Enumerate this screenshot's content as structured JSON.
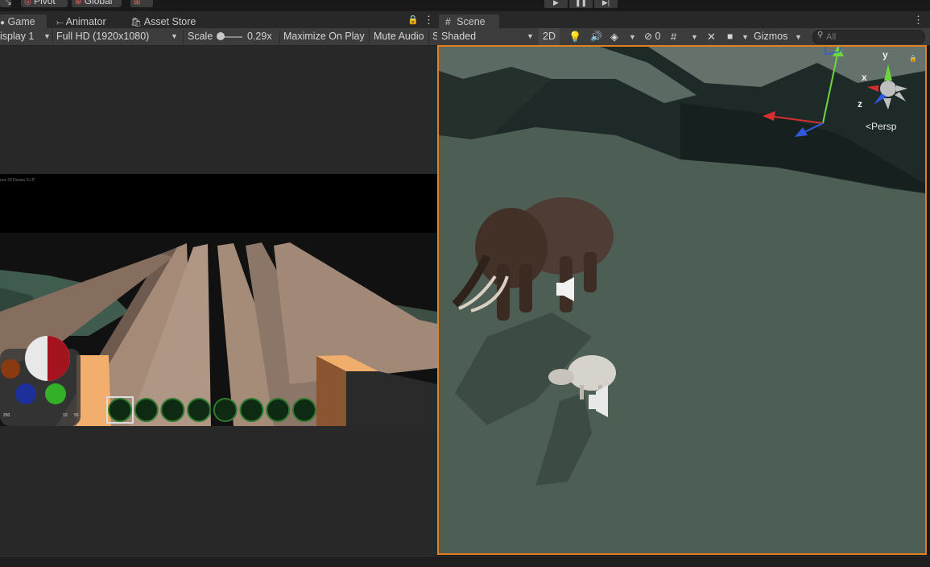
{
  "toolbar": {
    "pivot_label": "Pivot",
    "global_label": "Global",
    "play_icon": "play-icon",
    "pause_icon": "pause-icon",
    "step_icon": "step-icon"
  },
  "game_panel": {
    "tabs": [
      {
        "label": "Game",
        "icon": "game-icon",
        "active": true
      },
      {
        "label": "Animator",
        "icon": "animator-icon",
        "active": false
      },
      {
        "label": "Asset Store",
        "icon": "asset-store-icon",
        "active": false
      }
    ],
    "display": "isplay 1",
    "resolution": "Full HD (1920x1080)",
    "scale_label": "Scale",
    "scale_value": "0.29x",
    "scale_fraction": 0.1,
    "maximize_label": "Maximize On Play",
    "mute_label": "Mute Audio",
    "overflow_label": "S",
    "hud": {
      "title_text": "nce Of Dream S.I.P",
      "stat_left": "250",
      "stat_mid": "10",
      "stat_right": "50",
      "hotbar_slots": 8,
      "selected_slot": 1
    }
  },
  "scene_panel": {
    "tab_label": "Scene",
    "tab_icon": "scene-hash-icon",
    "shading_mode": "Shaded",
    "mode_2d": "2D",
    "hidden_count": "0",
    "gizmos_label": "Gizmos",
    "search_placeholder": "All",
    "axis_x": "x",
    "axis_y": "y",
    "axis_z": "z",
    "projection": "Persp"
  },
  "colors": {
    "accent_border": "#e0801e",
    "panel_bg": "#282828",
    "toolbar_bg": "#3c3c3c",
    "ground": "#4d5e55"
  }
}
